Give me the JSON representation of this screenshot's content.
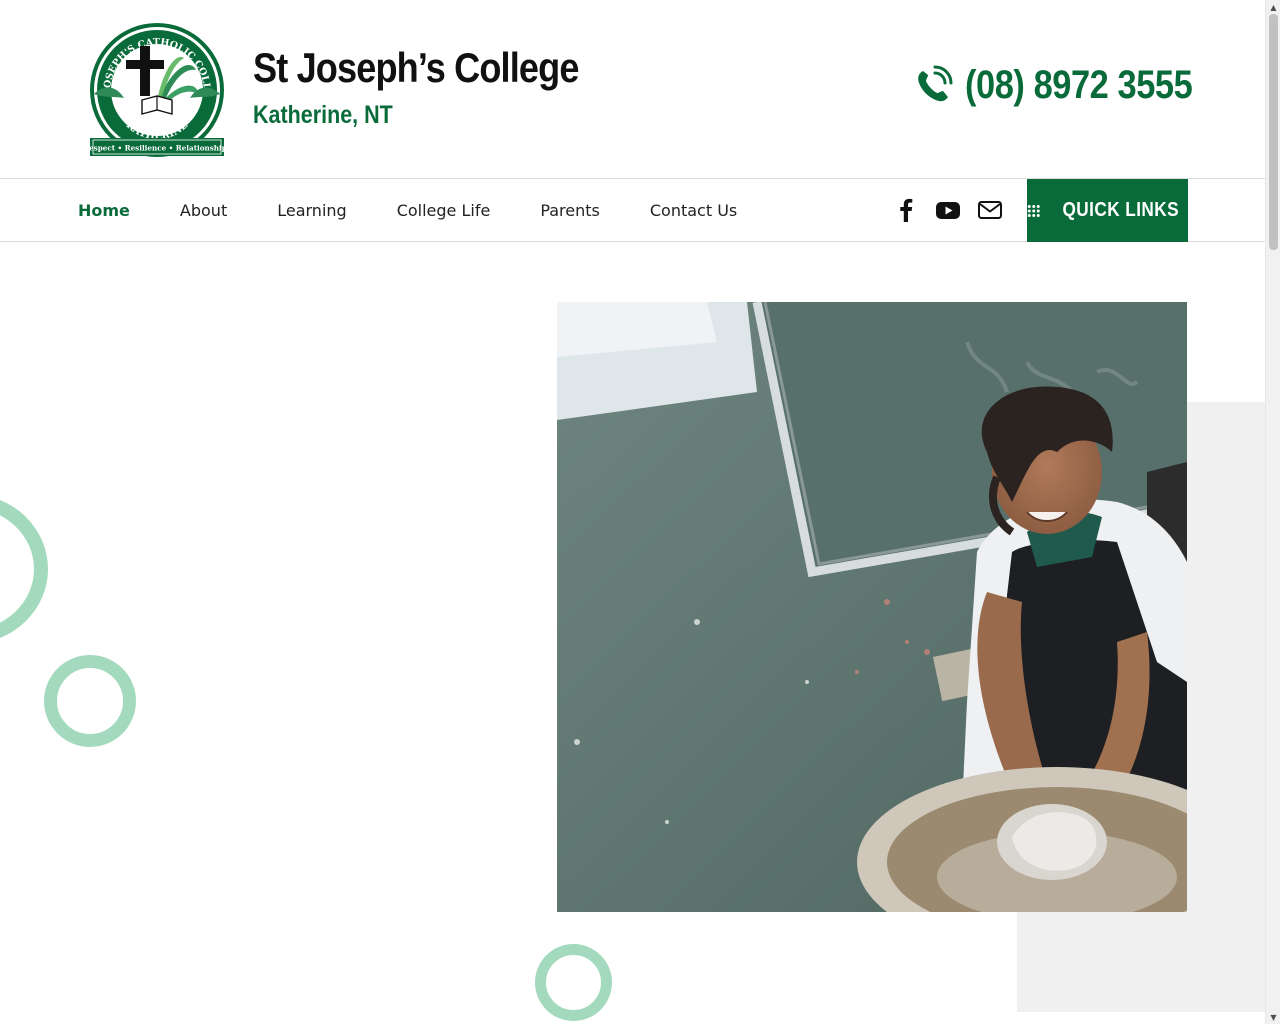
{
  "header": {
    "title": "St Joseph’s College",
    "subtitle": "Katherine, NT",
    "phone": "(08) 8972 3555",
    "logo": {
      "ring_text": "ST. JOSEPH'S CATHOLIC COLLEGE",
      "place": "KATHERINE",
      "motto": "Respect • Resilience • Relationships"
    }
  },
  "nav": {
    "items": [
      {
        "label": "Home",
        "active": true
      },
      {
        "label": "About",
        "active": false
      },
      {
        "label": "Learning",
        "active": false
      },
      {
        "label": "College Life",
        "active": false
      },
      {
        "label": "Parents",
        "active": false
      },
      {
        "label": "Contact Us",
        "active": false
      }
    ],
    "social_icons": [
      "facebook-icon",
      "youtube-icon",
      "mail-icon"
    ],
    "quick_links_label": "QUICK LINKS"
  },
  "hero": {
    "photo_icon": "student-pottery-photo"
  },
  "colors": {
    "brand_green": "#0a6b3a",
    "ring_green": "#a3d9bd",
    "grey_panel": "#f0f0f0"
  }
}
